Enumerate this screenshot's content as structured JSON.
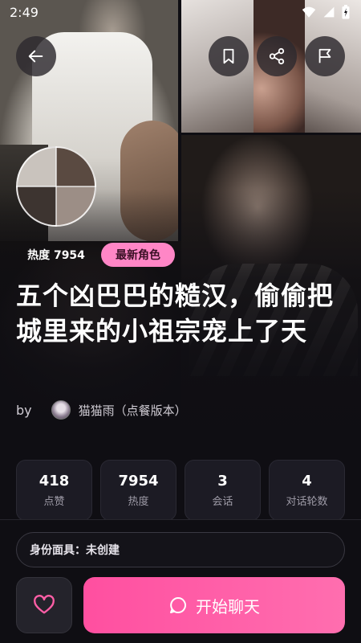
{
  "status_bar": {
    "time": "2:49"
  },
  "header": {
    "back_icon": "arrow-left-icon",
    "bookmark_icon": "bookmark-icon",
    "share_icon": "share-icon",
    "flag_icon": "flag-icon"
  },
  "tags": {
    "heat": "热度 7954",
    "new_role": "最新角色"
  },
  "title": "五个凶巴巴的糙汉，偷偷把城里来的小祖宗宠上了天",
  "author": {
    "by": "by",
    "name": "猫猫雨（点餐版本）"
  },
  "stats": [
    {
      "value": "418",
      "label": "点赞"
    },
    {
      "value": "7954",
      "label": "热度"
    },
    {
      "value": "3",
      "label": "会话"
    },
    {
      "value": "4",
      "label": "对话轮数"
    }
  ],
  "persona": {
    "label": "身份面具：未创建"
  },
  "actions": {
    "favorite_icon": "heart-icon",
    "chat_icon": "chat-bubble-icon",
    "start_chat": "开始聊天"
  },
  "colors": {
    "accent": "#ff5ea6",
    "tag_pink": "#ff86c6",
    "background": "#0f0e13"
  }
}
